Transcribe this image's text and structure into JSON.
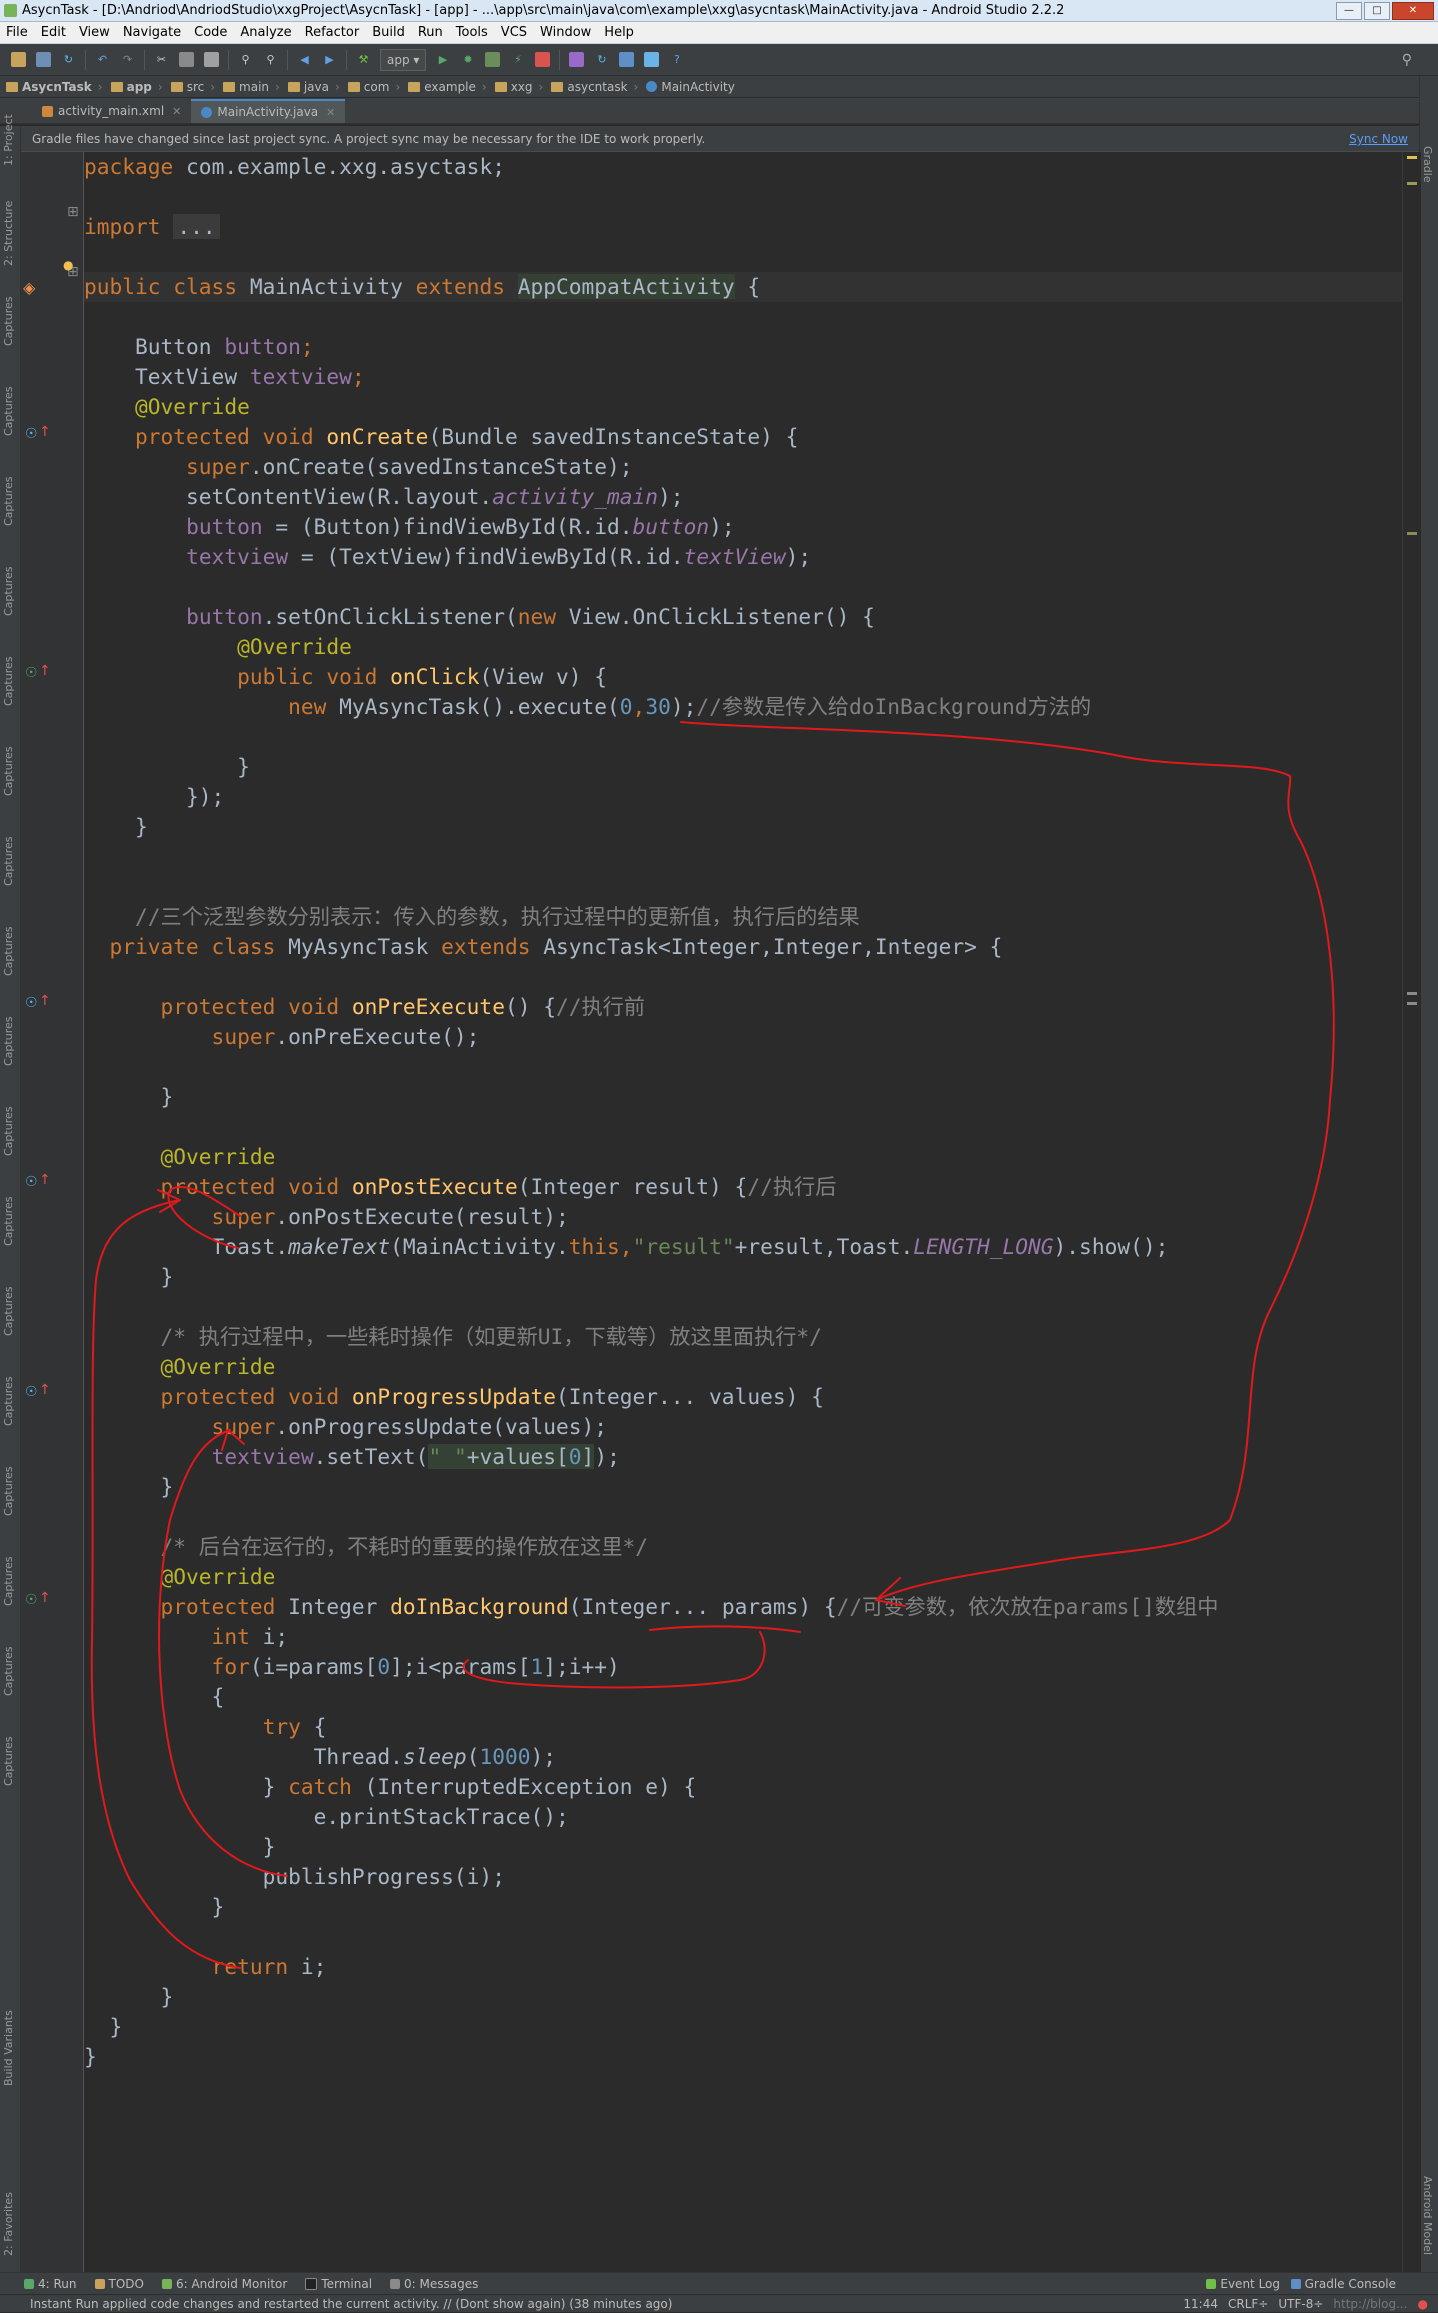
{
  "window": {
    "title": "AsycnTask - [D:\\Andriod\\AndriodStudio\\xxgProject\\AsycnTask] - [app] - ...\\app\\src\\main\\java\\com\\example\\xxg\\asycntask\\MainActivity.java - Android Studio 2.2.2"
  },
  "menu": [
    "File",
    "Edit",
    "View",
    "Navigate",
    "Code",
    "Analyze",
    "Refactor",
    "Build",
    "Run",
    "Tools",
    "VCS",
    "Window",
    "Help"
  ],
  "toolbar": {
    "run_config": "app"
  },
  "breadcrumbs": [
    "AsycnTask",
    "app",
    "src",
    "main",
    "java",
    "com",
    "example",
    "xxg",
    "asycntask",
    "MainActivity"
  ],
  "tabs": [
    {
      "label": "activity_main.xml",
      "active": false
    },
    {
      "label": "MainActivity.java",
      "active": true
    }
  ],
  "notification": {
    "text": "Gradle files have changed since last project sync. A project sync may be necessary for the IDE to work properly.",
    "action": "Sync Now"
  },
  "left_tool_tabs": [
    "1: Project",
    "2: Structure",
    "Captures",
    "Captures",
    "Captures",
    "Captures",
    "Captures",
    "Captures",
    "Captures",
    "Captures",
    "Captures",
    "Captures",
    "Captures",
    "Captures",
    "Captures",
    "Captures",
    "Captures",
    "Captures",
    "Captures",
    "Build Variants",
    "2: Favorites"
  ],
  "right_tool_tabs": [
    "Gradle",
    "Android Model"
  ],
  "code": {
    "l1": {
      "pkg_kw": "package",
      "pkg_name": " com.example.xxg.asyctask;"
    },
    "l2": {
      "kw": "import",
      "fold": "..."
    },
    "l3": {
      "mods": "public class",
      "name": " MainActivity ",
      "ext": "extends",
      "parent": "AppCompatActivity",
      "rest": " {"
    },
    "l4": {
      "type": "    Button ",
      "field": "button",
      "semi": ";"
    },
    "l5": {
      "type": "    TextView ",
      "field": "textview",
      "semi": ";"
    },
    "l6": {
      "ann": "    @Override"
    },
    "l7": {
      "mods": "    protected void ",
      "fn": "onCreate",
      "args": "(Bundle savedInstanceState) {"
    },
    "l8": {
      "kw": "        super",
      "rest": ".onCreate(savedInstanceState);"
    },
    "l9": {
      "pre": "        setContentView(R.layout.",
      "fi": "activity_main",
      "post": ");"
    },
    "l10": {
      "pre": "        ",
      "field": "button",
      "mid": " = (Button)findViewById(R.id.",
      "fi": "button",
      "post": ");"
    },
    "l11": {
      "pre": "        ",
      "field": "textview",
      "mid": " = (TextView)findViewById(R.id.",
      "fi": "textView",
      "post": ");"
    },
    "l12": {
      "pre": "        ",
      "field": "button",
      "mid": ".setOnClickListener(",
      "kw": "new",
      "post": " View.OnClickListener() {"
    },
    "l13": {
      "ann": "            @Override"
    },
    "l14": {
      "mods": "            public void ",
      "fn": "onClick",
      "args": "(View v) {"
    },
    "l15": {
      "pre": "                ",
      "kw": "new",
      "mid": " MyAsyncTask().execute(",
      "n1": "0",
      "comma": ",",
      "n2": "30",
      "post": ");",
      "cm": "//参数是传入给doInBackground方法的"
    },
    "l16": {
      "text": "            }"
    },
    "l17": {
      "text": "        });"
    },
    "l18": {
      "text": "    }"
    },
    "l19": {
      "cm": "    //三个泛型参数分别表示：传入的参数，执行过程中的更新值，执行后的结果"
    },
    "l20": {
      "mods": "  private class",
      "name": " MyAsyncTask ",
      "ext": "extends",
      "rest": " AsyncTask<Integer,Integer,Integer> {"
    },
    "l21": {
      "mods": "      protected void ",
      "fn": "onPreExecute",
      "args": "() {",
      "cm": "//执行前"
    },
    "l22": {
      "kw": "          super",
      "rest": ".onPreExecute();"
    },
    "l23": {
      "text": "      }"
    },
    "l24": {
      "ann": "      @Override"
    },
    "l25": {
      "mods": "      protected void ",
      "fn": "onPostExecute",
      "args": "(Integer result) {",
      "cm": "//执行后"
    },
    "l26": {
      "kw": "          super",
      "rest": ".onPostExecute(result);"
    },
    "l27": {
      "pre": "          Toast.",
      "si": "makeText",
      "mid": "(MainActivity.",
      "kw": "this",
      "comma": ",",
      "str": "\"result\"",
      "mid2": "+result,Toast.",
      "fi": "LENGTH_LONG",
      "post": ").show();"
    },
    "l28": {
      "text": "      }"
    },
    "l29": {
      "cm": "      /* 执行过程中，一些耗时操作（如更新UI，下载等）放这里面执行*/"
    },
    "l30": {
      "ann": "      @Override"
    },
    "l31": {
      "mods": "      protected void ",
      "fn": "onProgressUpdate",
      "args": "(Integer... values) {"
    },
    "l32": {
      "kw": "          super",
      "rest": ".onProgressUpdate(values);"
    },
    "l33": {
      "pre": "          ",
      "field": "textview",
      "mid": ".setText(",
      "str": "\" \"",
      "hl": "+values[",
      "n": "0",
      "hl2": "]",
      "post": ");"
    },
    "l34": {
      "text": "      }"
    },
    "l35": {
      "cm": "      /* 后台在运行的，不耗时的重要的操作放在这里*/"
    },
    "l36": {
      "ann": "      @Override"
    },
    "l37": {
      "mods": "      protected ",
      "type": "Integer ",
      "fn": "doInBackground",
      "args": "(Integer... params) {",
      "cm": "//可变参数，依次放在params[]数组中"
    },
    "l38": {
      "kw": "          int",
      "rest": " i;"
    },
    "l39": {
      "kw": "          for",
      "pre": "(i=params[",
      "n1": "0",
      "mid": "];i<params[",
      "n2": "1",
      "post": "];i++)"
    },
    "l40": {
      "text": "          {"
    },
    "l41": {
      "kw": "              try",
      "rest": " {"
    },
    "l42": {
      "pre": "                  Thread.",
      "si": "sleep",
      "mid": "(",
      "n": "1000",
      "post": ");"
    },
    "l43": {
      "pre": "              } ",
      "kw": "catch",
      "post": " (InterruptedException e) {"
    },
    "l44": {
      "text": "                  e.printStackTrace();"
    },
    "l45": {
      "text": "              }"
    },
    "l46": {
      "text": "              publishProgress(i);"
    },
    "l47": {
      "text": "          }"
    },
    "l48": {
      "kw": "          return",
      "rest": " i;"
    },
    "l49": {
      "text": "      }"
    },
    "l50": {
      "text": "  }"
    },
    "l51": {
      "text": "}"
    }
  },
  "bottom_tabs": [
    "4: Run",
    "TODO",
    "6: Android Monitor",
    "Terminal",
    "0: Messages",
    "Event Log",
    "Gradle Console"
  ],
  "status": {
    "message": "Instant Run applied code changes and restarted the current activity. // (Dont show again) (38 minutes ago)",
    "caret": "11:44",
    "line_sep": "CRLF÷",
    "encoding": "UTF-8÷",
    "watermark": "http://blog..."
  },
  "colors": {
    "background": "#2b2b2b",
    "keyword": "#cc7832",
    "annotation": "#bbb529",
    "method": "#ffc66d",
    "field": "#9876aa",
    "number": "#6897bb",
    "string": "#6a8759",
    "comment": "#808080",
    "ink": "#e0191c"
  }
}
